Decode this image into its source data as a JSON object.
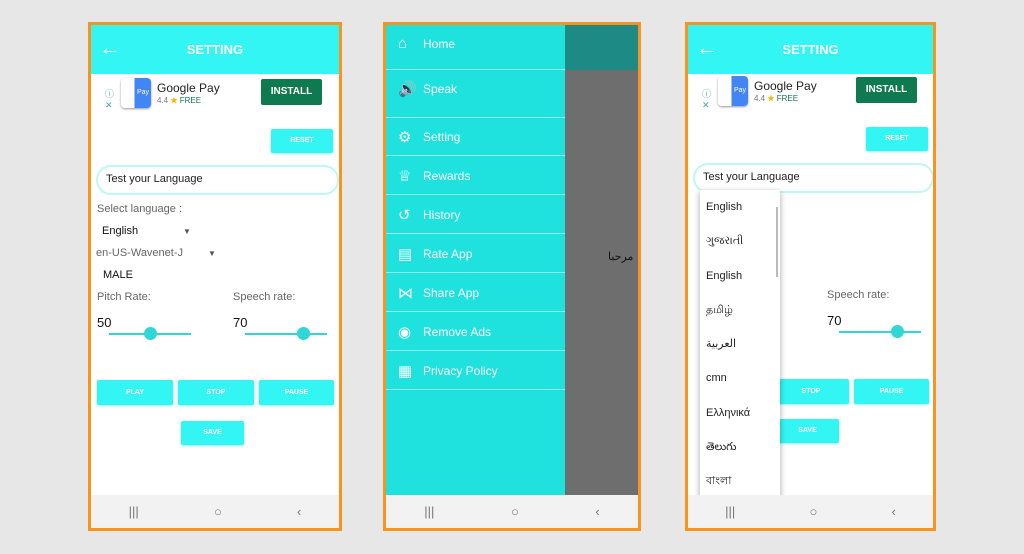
{
  "settings": {
    "title": "SETTING",
    "back_icon": "arrow-left-icon",
    "ad": {
      "name": "Google Pay",
      "rating": "4.4",
      "star": "★",
      "price": "FREE",
      "install": "INSTALL"
    },
    "reset": "RESET",
    "test_input": "Test your Language",
    "select_language_label": "Select language :",
    "language": "English",
    "voice": "en-US-Wavenet-J",
    "gender": "MALE",
    "pitch_label": "Pitch Rate:",
    "speech_label": "Speech rate:",
    "pitch_value": "50",
    "speech_value": "70",
    "play": "PLAY",
    "stop": "STOP",
    "pause": "PAUSE",
    "save": "SAVE"
  },
  "drawer": {
    "items": [
      {
        "label": "Home",
        "icon": "⌂"
      },
      {
        "label": "Speak",
        "icon": "🔊"
      },
      {
        "label": "Setting",
        "icon": "⚙"
      },
      {
        "label": "Rewards",
        "icon": "♕"
      },
      {
        "label": "History",
        "icon": "↺"
      },
      {
        "label": "Rate App",
        "icon": "▤"
      },
      {
        "label": "Share App",
        "icon": "⋈"
      },
      {
        "label": "Remove Ads",
        "icon": "◉"
      },
      {
        "label": "Privacy Policy",
        "icon": "▦"
      }
    ],
    "background_text": "مرحبا"
  },
  "dropdown": {
    "options": [
      "English",
      "ગુજરાતી",
      "English",
      "தமிழ்",
      "العربية",
      "cmn",
      "Ελληνικά",
      "తెలుగు",
      "বাংলা"
    ]
  },
  "nav": {
    "recents": "|||",
    "home": "○",
    "back": "‹"
  },
  "colors": {
    "accent": "#33f5f3",
    "install": "#0f7a4f",
    "frame": "#f7941d"
  }
}
